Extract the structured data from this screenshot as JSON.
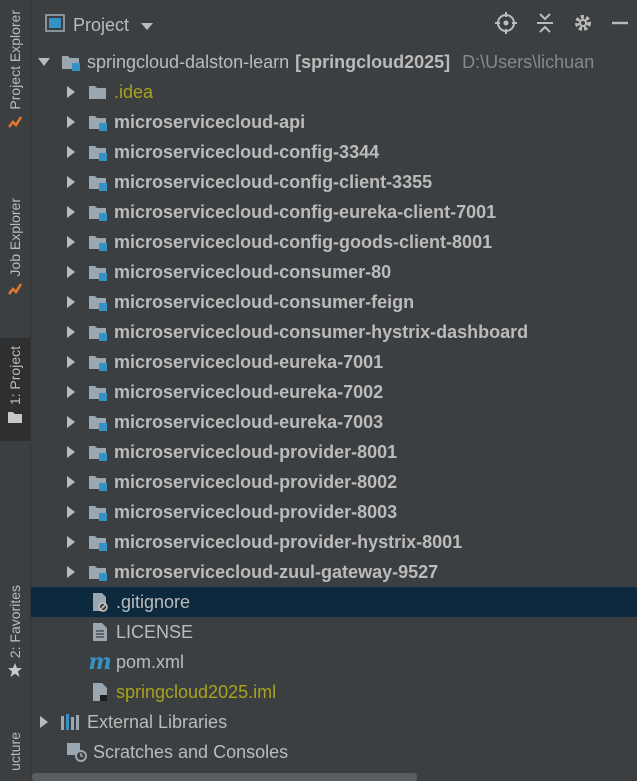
{
  "sidebar": {
    "tabs": [
      {
        "label": "Project Explorer"
      },
      {
        "label": "Job Explorer"
      },
      {
        "label": "1: Project"
      },
      {
        "label": "2: Favorites"
      },
      {
        "label": "ucture"
      }
    ]
  },
  "header": {
    "title": "Project"
  },
  "tree": {
    "root": {
      "name": "springcloud-dalston-learn",
      "module": "[springcloud2025]",
      "path": "D:\\Users\\lichuan"
    },
    "folders": [
      {
        "name": ".idea"
      },
      {
        "name": "microservicecloud-api"
      },
      {
        "name": "microservicecloud-config-3344"
      },
      {
        "name": "microservicecloud-config-client-3355"
      },
      {
        "name": "microservicecloud-config-eureka-client-7001"
      },
      {
        "name": "microservicecloud-config-goods-client-8001"
      },
      {
        "name": "microservicecloud-consumer-80"
      },
      {
        "name": "microservicecloud-consumer-feign"
      },
      {
        "name": "microservicecloud-consumer-hystrix-dashboard"
      },
      {
        "name": "microservicecloud-eureka-7001"
      },
      {
        "name": "microservicecloud-eureka-7002"
      },
      {
        "name": "microservicecloud-eureka-7003"
      },
      {
        "name": "microservicecloud-provider-8001"
      },
      {
        "name": "microservicecloud-provider-8002"
      },
      {
        "name": "microservicecloud-provider-8003"
      },
      {
        "name": "microservicecloud-provider-hystrix-8001"
      },
      {
        "name": "microservicecloud-zuul-gateway-9527"
      }
    ],
    "files": [
      {
        "name": ".gitignore"
      },
      {
        "name": "LICENSE"
      },
      {
        "name": "pom.xml"
      },
      {
        "name": "springcloud2025.iml"
      }
    ],
    "external_libraries": "External Libraries",
    "scratches": "Scratches and Consoles"
  },
  "colors": {
    "background": "#3c3f41",
    "selection": "#0d293e",
    "text": "#bbbbbb",
    "ignored_text": "#a8a31f",
    "module_badge": "#3592c4"
  }
}
